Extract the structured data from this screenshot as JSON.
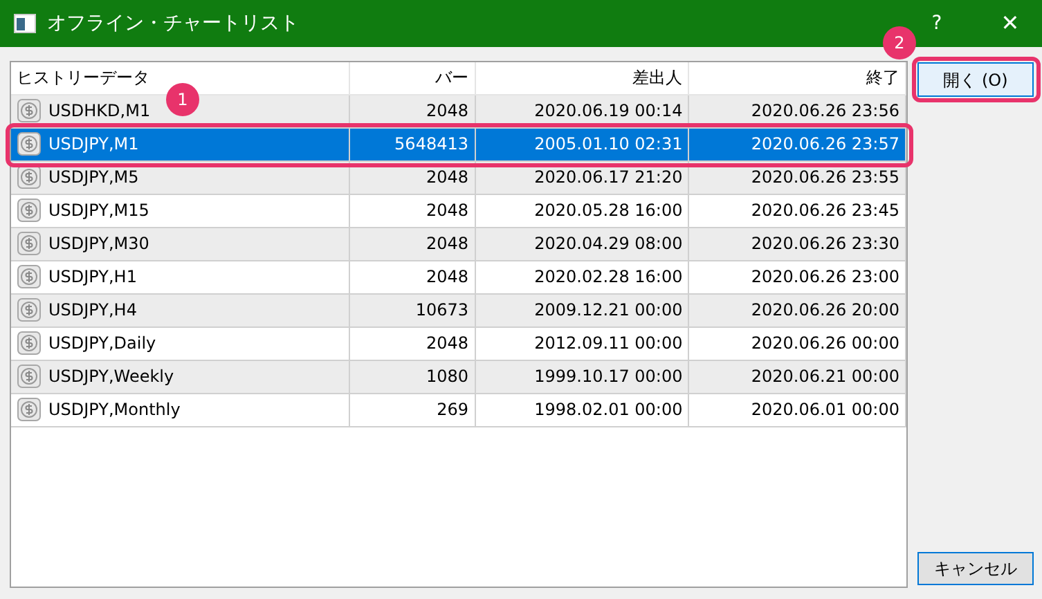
{
  "window": {
    "title": "オフライン・チャートリスト",
    "help": "?",
    "close": "✕"
  },
  "table": {
    "columns": [
      "ヒストリーデータ",
      "バー",
      "差出人",
      "終了"
    ],
    "rows": [
      {
        "cells": [
          "USDHKD,M1",
          "2048",
          "2020.06.19 00:14",
          "2020.06.26 23:56"
        ],
        "selected": false
      },
      {
        "cells": [
          "USDJPY,M1",
          "5648413",
          "2005.01.10 02:31",
          "2020.06.26 23:57"
        ],
        "selected": true
      },
      {
        "cells": [
          "USDJPY,M5",
          "2048",
          "2020.06.17 21:20",
          "2020.06.26 23:55"
        ],
        "selected": false
      },
      {
        "cells": [
          "USDJPY,M15",
          "2048",
          "2020.05.28 16:00",
          "2020.06.26 23:45"
        ],
        "selected": false
      },
      {
        "cells": [
          "USDJPY,M30",
          "2048",
          "2020.04.29 08:00",
          "2020.06.26 23:30"
        ],
        "selected": false
      },
      {
        "cells": [
          "USDJPY,H1",
          "2048",
          "2020.02.28 16:00",
          "2020.06.26 23:00"
        ],
        "selected": false
      },
      {
        "cells": [
          "USDJPY,H4",
          "10673",
          "2009.12.21 00:00",
          "2020.06.26 20:00"
        ],
        "selected": false
      },
      {
        "cells": [
          "USDJPY,Daily",
          "2048",
          "2012.09.11 00:00",
          "2020.06.26 00:00"
        ],
        "selected": false
      },
      {
        "cells": [
          "USDJPY,Weekly",
          "1080",
          "1999.10.17 00:00",
          "2020.06.21 00:00"
        ],
        "selected": false
      },
      {
        "cells": [
          "USDJPY,Monthly",
          "269",
          "1998.02.01 00:00",
          "2020.06.01 00:00"
        ],
        "selected": false
      }
    ]
  },
  "buttons": {
    "open": "開く (O)",
    "cancel": "キャンセル"
  },
  "annotations": [
    "1",
    "2"
  ]
}
